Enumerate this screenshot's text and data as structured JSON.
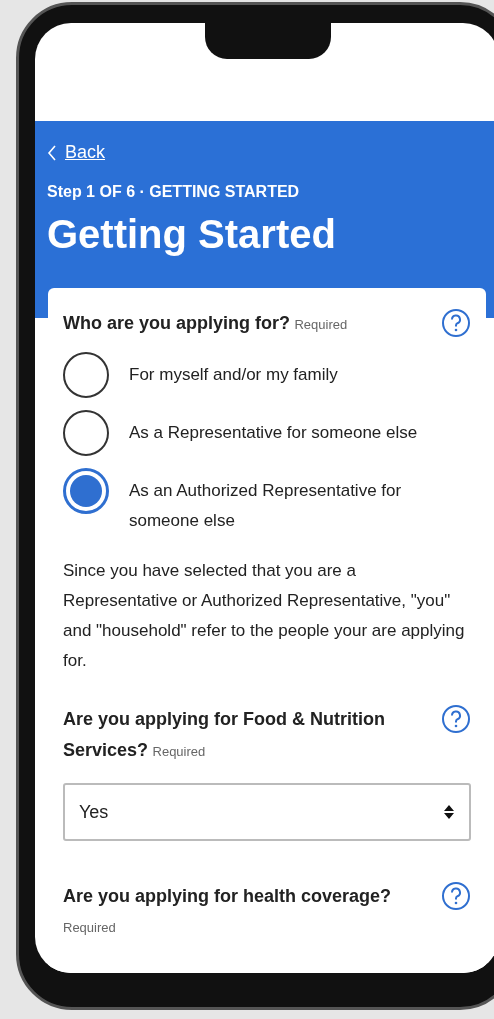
{
  "header": {
    "back": "Back",
    "step": "Step 1 OF 6 · GETTING STARTED",
    "title": "Getting Started"
  },
  "questions": [
    {
      "kind": "radio",
      "label": "Who are you applying for?",
      "required": "Required",
      "options": [
        {
          "label": "For myself and/or my family",
          "selected": false
        },
        {
          "label": "As a Representative for someone else",
          "selected": false
        },
        {
          "label": "As an Authorized Representative for someone else",
          "selected": true
        }
      ],
      "note": "Since you have selected that you are a Representative or Authorized Representative, \"you\" and \"household\" refer to the people your are applying for."
    },
    {
      "kind": "select",
      "label": "Are you applying for Food & Nutrition Services?",
      "required": "Required",
      "value": "Yes"
    },
    {
      "kind": "plain",
      "label": "Are you applying for health coverage?",
      "required": "Required"
    }
  ]
}
